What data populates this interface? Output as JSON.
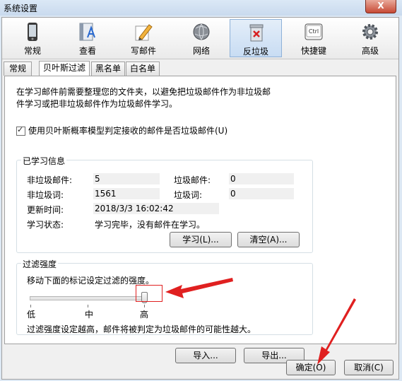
{
  "window": {
    "title": "系统设置",
    "close_glyph": "X"
  },
  "toolbar": {
    "items": [
      {
        "label": "常规",
        "icon": "phone-icon"
      },
      {
        "label": "查看",
        "icon": "book-icon"
      },
      {
        "label": "写邮件",
        "icon": "pencil-icon"
      },
      {
        "label": "网络",
        "icon": "globe-icon"
      },
      {
        "label": "反垃圾",
        "icon": "trash-icon"
      },
      {
        "label": "快捷键",
        "icon": "ctrl-key-icon"
      },
      {
        "label": "高级",
        "icon": "gear-icon"
      }
    ],
    "active": "反垃圾",
    "ctrl_text": "Ctrl"
  },
  "tabs": [
    {
      "label": "常规"
    },
    {
      "label": "贝叶斯过滤"
    },
    {
      "label": "黑名单"
    },
    {
      "label": "白名单"
    }
  ],
  "active_tab": "贝叶斯过滤",
  "description": {
    "line1": "在学习邮件前需要整理您的文件夹，以避免把垃圾邮件作为非垃圾邮",
    "line2": "件学习或把非垃圾邮件作为垃圾邮件学习。"
  },
  "bayes_checkbox": {
    "label": "使用贝叶斯概率模型判定接收的邮件是否垃圾邮件(U)",
    "checked": true
  },
  "learned_info": {
    "title": "已学习信息",
    "nonspam_mail_label": "非垃圾邮件:",
    "nonspam_mail_value": "5",
    "spam_mail_label": "垃圾邮件:",
    "spam_mail_value": "0",
    "nonspam_word_label": "非垃圾词:",
    "nonspam_word_value": "1561",
    "spam_word_label": "垃圾词:",
    "spam_word_value": "0",
    "update_time_label": "更新时间:",
    "update_time_value": "2018/3/3 16:02:42",
    "status_label": "学习状态:",
    "status_value": "学习完毕，没有邮件在学习。",
    "learn_button": "学习(L)...",
    "clear_button": "清空(A)..."
  },
  "filter_strength": {
    "title": "过滤强度",
    "instruction": "移动下面的标记设定过滤的强度。",
    "levels": [
      "低",
      "中",
      "高"
    ],
    "current_level_index": 2,
    "note": "过滤强度设定越高，邮件将被判定为垃圾邮件的可能性越大。"
  },
  "import_button": "导入...",
  "export_button": "导出...",
  "ok_button": "确定(O)",
  "cancel_button": "取消(C)",
  "colors": {
    "accent": "#8eb1d8",
    "annotation": "#e02020"
  }
}
